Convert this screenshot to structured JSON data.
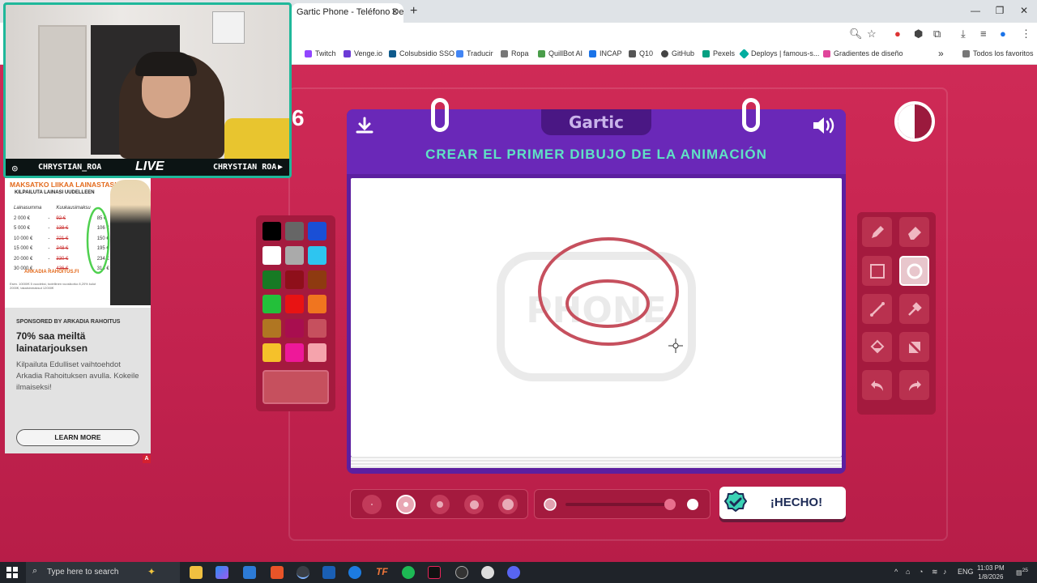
{
  "browser": {
    "tab_title": "Gartic Phone - Teléfono Descom",
    "tab_close": "✕",
    "new_tab": "+",
    "window_controls": {
      "minimize": "—",
      "maximize": "❐",
      "close": "✕"
    },
    "bookmarks": [
      {
        "label": "Twitch",
        "color": "#9146ff"
      },
      {
        "label": "Venge.io",
        "color": "#6b3ad6"
      },
      {
        "label": "Colsubsidio SSO",
        "color": "#0f5a8c"
      },
      {
        "label": "Traducir",
        "color": "#4285f4"
      },
      {
        "label": "Ropa",
        "color": "#777777"
      },
      {
        "label": "QuillBot AI",
        "color": "#4a9d4a"
      },
      {
        "label": "INCAP",
        "color": "#1a73e8"
      },
      {
        "label": "Q10",
        "color": "#555555"
      },
      {
        "label": "GitHub",
        "color": "#444444"
      },
      {
        "label": "Pexels",
        "color": "#05a081"
      },
      {
        "label": "Deploys | famous-s...",
        "color": "#00ad9f"
      },
      {
        "label": "Gradientes de diseño",
        "color": "#e0459b"
      }
    ],
    "all_bookmarks": "Todos los favoritos",
    "more_bookmarks": "»"
  },
  "game": {
    "round_number": "6",
    "logo": "Gartic",
    "title": "CREAR EL PRIMER DIBUJO DE LA ANIMACIÓN",
    "timer_remaining": 0.5,
    "palette": [
      "#000000",
      "#666666",
      "#1a4fd6",
      "#ffffff",
      "#aaaaaa",
      "#2ec5f0",
      "#177a24",
      "#8e0f1a",
      "#8e3a10",
      "#23c03a",
      "#e81313",
      "#f0751f",
      "#b07622",
      "#a80e4f",
      "#c6505e",
      "#f5c12a",
      "#ee1899",
      "#f5a3ac"
    ],
    "current_color": "#c6505e",
    "tools": [
      {
        "name": "pencil-tool",
        "active": false
      },
      {
        "name": "eraser-tool",
        "active": false
      },
      {
        "name": "rectangle-tool",
        "active": false
      },
      {
        "name": "ellipse-tool",
        "active": true
      },
      {
        "name": "line-tool",
        "active": false
      },
      {
        "name": "eyedropper-tool",
        "active": false
      },
      {
        "name": "fill-tool",
        "active": false
      },
      {
        "name": "clear-tool",
        "active": false
      },
      {
        "name": "undo-tool",
        "active": false
      },
      {
        "name": "redo-tool",
        "active": false
      }
    ],
    "brush_sizes_selected": 2,
    "opacity_value": 0.85,
    "done_label": "¡HECHO!"
  },
  "webcam": {
    "left_handle": "CHRYSTIAN_ROA",
    "live_label": "LIVE",
    "right_handle": "CHRYSTIAN ROA"
  },
  "ad": {
    "headline": "MAKSATKO LIIKAA LAINASTASI?",
    "subhead": "KILPAILUTA LAINASI UUDELLEEN",
    "col_amount": "Lainasumma",
    "col_monthly": "Kuukausimaksu",
    "rows": [
      {
        "amount": "2 000 €",
        "old": "92 €",
        "new": "85 €"
      },
      {
        "amount": "5 000 €",
        "old": "138 €",
        "new": "106 €"
      },
      {
        "amount": "10 000 €",
        "old": "221 €",
        "new": "150 €"
      },
      {
        "amount": "15 000 €",
        "old": "248 €",
        "new": "195 €"
      },
      {
        "amount": "20 000 €",
        "old": "330 €",
        "new": "234 €"
      },
      {
        "amount": "30 000 €",
        "old": "436 €",
        "new": "314 €"
      }
    ],
    "brand": "ARKADIA RAHOITUS.FI",
    "fine_print": "Esim. 10000€ 5 vuodeksi, todellinen vuosikorko 8,20% kulut 2000€, takaisinmaksut 12000€",
    "sponsor": "SPONSORED BY ARKADIA RAHOITUS",
    "title": "70% saa meiltä lainatarjouksen",
    "body": "Kilpailuta Edulliset vaihtoehdot Arkadia Rahoituksen avulla. Kokeile ilmaiseksi!",
    "cta": "LEARN MORE",
    "badge": "A"
  },
  "taskbar": {
    "search_placeholder": "Type here to search",
    "language": "ENG",
    "time": "11:03 PM",
    "date": "1/8/2026",
    "notifications": "25"
  }
}
